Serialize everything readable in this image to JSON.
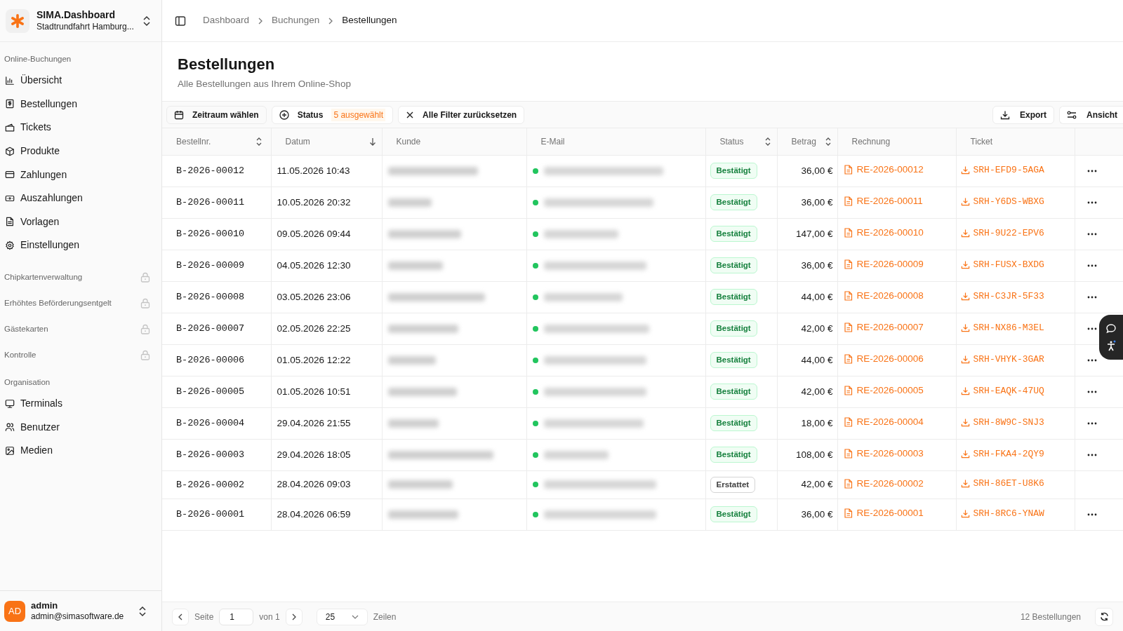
{
  "brand": {
    "title_bold": "SIMA",
    "title_rest": ".Dashboard",
    "subtitle": "Stadtrundfahrt Hamburg..."
  },
  "sidebar": {
    "sections": [
      {
        "label": "Online-Buchungen",
        "items": [
          {
            "label": "Übersicht"
          },
          {
            "label": "Bestellungen"
          },
          {
            "label": "Tickets"
          },
          {
            "label": "Produkte"
          },
          {
            "label": "Zahlungen"
          },
          {
            "label": "Auszahlungen"
          },
          {
            "label": "Vorlagen"
          },
          {
            "label": "Einstellungen"
          }
        ]
      },
      {
        "label": "Chipkartenverwaltung",
        "locked": true
      },
      {
        "label": "Erhöhtes Beförderungsentgelt",
        "locked": true
      },
      {
        "label": "Gästekarten",
        "locked": true
      },
      {
        "label": "Kontrolle",
        "locked": true
      },
      {
        "label": "Organisation",
        "locked": false,
        "items": [
          {
            "label": "Terminals"
          },
          {
            "label": "Benutzer"
          },
          {
            "label": "Medien"
          }
        ]
      }
    ]
  },
  "user": {
    "initials": "AD",
    "name": "admin",
    "email": "admin@simasoftware.de"
  },
  "breadcrumb": [
    {
      "label": "Dashboard",
      "current": false
    },
    {
      "label": "Buchungen",
      "current": false
    },
    {
      "label": "Bestellungen",
      "current": true
    }
  ],
  "page": {
    "title": "Bestellungen",
    "subtitle": "Alle Bestellungen aus Ihrem Online-Shop"
  },
  "filters": {
    "date": "Zeitraum wählen",
    "status": "Status",
    "status_count": "5 ausgewählt",
    "reset": "Alle Filter zurücksetzen",
    "export": "Export",
    "view": "Ansicht"
  },
  "table": {
    "columns": [
      {
        "label": "Bestellnr.",
        "kind": "sortable"
      },
      {
        "label": "Datum",
        "kind": "sorted"
      },
      {
        "label": "Kunde",
        "kind": "plain"
      },
      {
        "label": "E-Mail",
        "kind": "plain"
      },
      {
        "label": "Status",
        "kind": "sortable"
      },
      {
        "label": "Betrag",
        "kind": "sortable"
      },
      {
        "label": "Rechnung",
        "kind": "plain"
      },
      {
        "label": "Ticket",
        "kind": "plain"
      }
    ],
    "rows": [
      {
        "id": "B-2026-00012",
        "date": "11.05.2026 10:43",
        "status": "Bestätigt",
        "kind": "confirmed",
        "amount": "36,00 €",
        "invoice": "RE-2026-00012",
        "ticket": "SRH-EFD9-5AGA",
        "menu": true
      },
      {
        "id": "B-2026-00011",
        "date": "10.05.2026 20:32",
        "status": "Bestätigt",
        "kind": "confirmed",
        "amount": "36,00 €",
        "invoice": "RE-2026-00011",
        "ticket": "SRH-Y6DS-WBXG",
        "menu": true
      },
      {
        "id": "B-2026-00010",
        "date": "09.05.2026 09:44",
        "status": "Bestätigt",
        "kind": "confirmed",
        "amount": "147,00 €",
        "invoice": "RE-2026-00010",
        "ticket": "SRH-9U22-EPV6",
        "menu": true
      },
      {
        "id": "B-2026-00009",
        "date": "04.05.2026 12:30",
        "status": "Bestätigt",
        "kind": "confirmed",
        "amount": "36,00 €",
        "invoice": "RE-2026-00009",
        "ticket": "SRH-FUSX-BXDG",
        "menu": true
      },
      {
        "id": "B-2026-00008",
        "date": "03.05.2026 23:06",
        "status": "Bestätigt",
        "kind": "confirmed",
        "amount": "44,00 €",
        "invoice": "RE-2026-00008",
        "ticket": "SRH-C3JR-5F33",
        "menu": true
      },
      {
        "id": "B-2026-00007",
        "date": "02.05.2026 22:25",
        "status": "Bestätigt",
        "kind": "confirmed",
        "amount": "42,00 €",
        "invoice": "RE-2026-00007",
        "ticket": "SRH-NX86-M3EL",
        "menu": true
      },
      {
        "id": "B-2026-00006",
        "date": "01.05.2026 12:22",
        "status": "Bestätigt",
        "kind": "confirmed",
        "amount": "44,00 €",
        "invoice": "RE-2026-00006",
        "ticket": "SRH-VHYK-3GAR",
        "menu": true
      },
      {
        "id": "B-2026-00005",
        "date": "01.05.2026 10:51",
        "status": "Bestätigt",
        "kind": "confirmed",
        "amount": "42,00 €",
        "invoice": "RE-2026-00005",
        "ticket": "SRH-EAQK-47UQ",
        "menu": true
      },
      {
        "id": "B-2026-00004",
        "date": "29.04.2026 21:55",
        "status": "Bestätigt",
        "kind": "confirmed",
        "amount": "18,00 €",
        "invoice": "RE-2026-00004",
        "ticket": "SRH-8W9C-SNJ3",
        "menu": true
      },
      {
        "id": "B-2026-00003",
        "date": "29.04.2026 18:05",
        "status": "Bestätigt",
        "kind": "confirmed",
        "amount": "108,00 €",
        "invoice": "RE-2026-00003",
        "ticket": "SRH-FKA4-2QY9",
        "menu": true
      },
      {
        "id": "B-2026-00002",
        "date": "28.04.2026 09:03",
        "status": "Erstattet",
        "kind": "refunded",
        "amount": "42,00 €",
        "invoice": "RE-2026-00002",
        "ticket": "SRH-86ET-U8K6",
        "menu": false
      },
      {
        "id": "B-2026-00001",
        "date": "28.04.2026 06:59",
        "status": "Bestätigt",
        "kind": "confirmed",
        "amount": "36,00 €",
        "invoice": "RE-2026-00001",
        "ticket": "SRH-8RC6-YNAW",
        "menu": true
      }
    ]
  },
  "pagination": {
    "page_label": "Seite",
    "page": "1",
    "of": "von 1",
    "per_page": "25",
    "rows_label": "Zeilen",
    "total": "12 Bestellungen"
  }
}
